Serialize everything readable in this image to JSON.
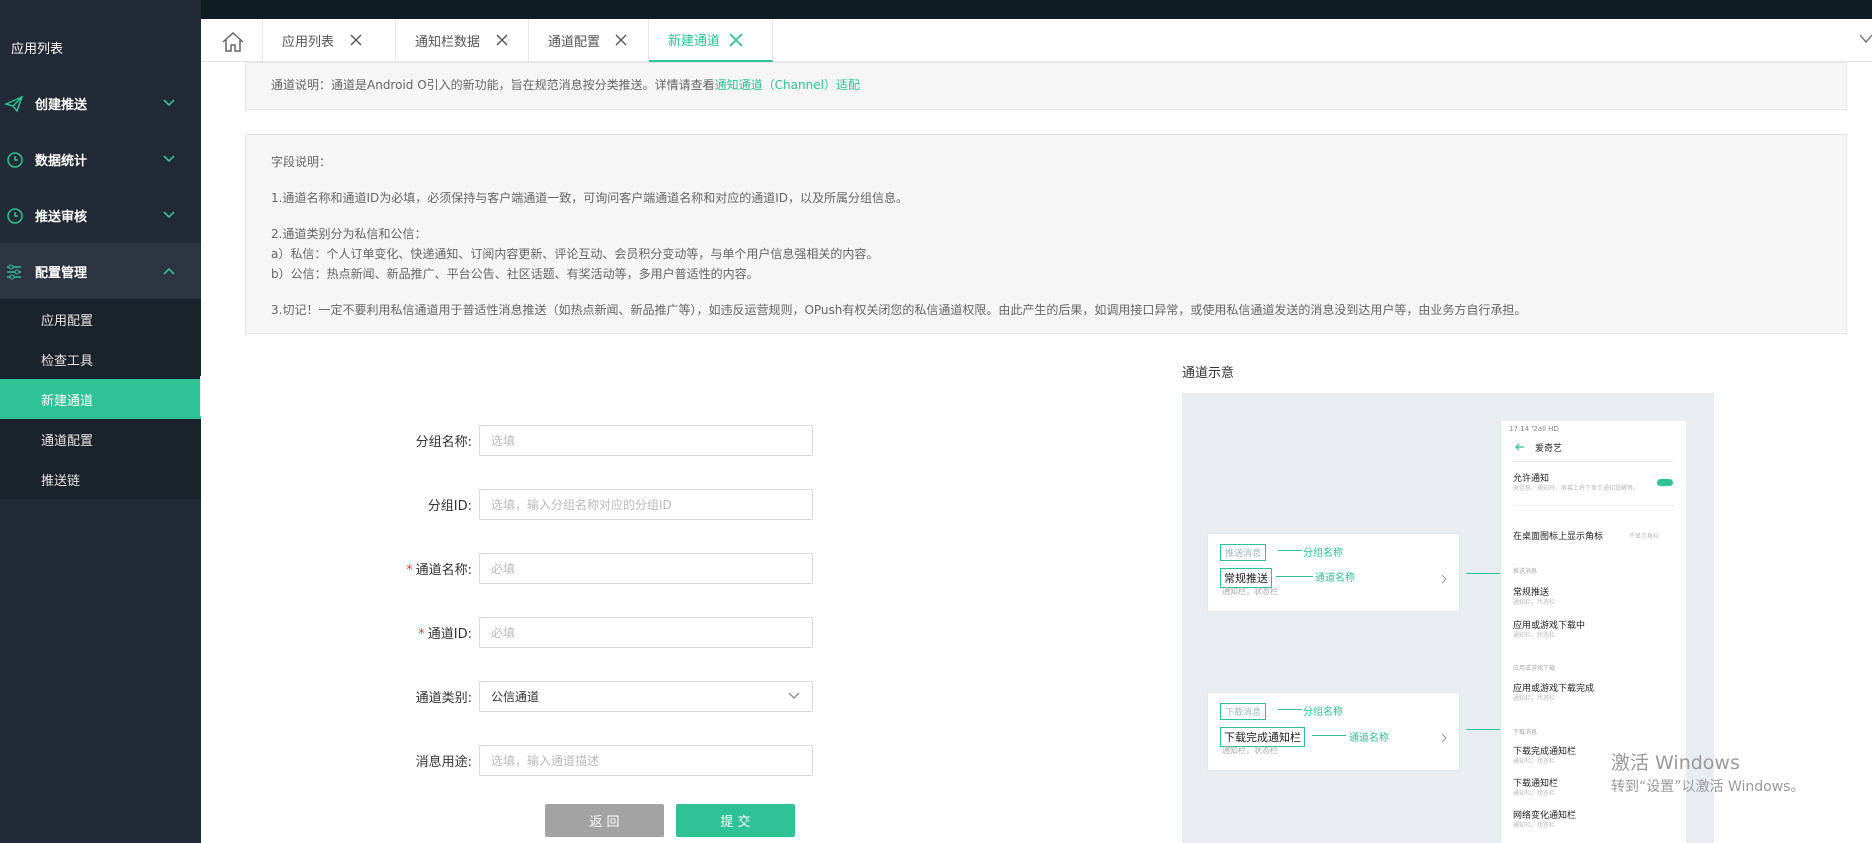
{
  "sidebar": {
    "title": "应用列表",
    "groups": [
      {
        "label": "创建推送"
      },
      {
        "label": "数据统计"
      },
      {
        "label": "推送审核"
      },
      {
        "label": "配置管理"
      }
    ],
    "subitems": [
      "应用配置",
      "检查工具",
      "新建通道",
      "通道配置",
      "推送链"
    ]
  },
  "tabs": [
    {
      "label": "应用列表"
    },
    {
      "label": "通知栏数据"
    },
    {
      "label": "通道配置"
    },
    {
      "label": "新建通道"
    }
  ],
  "notice": {
    "prefix": "通道说明：通道是Android O引入的新功能，旨在规范消息按分类推送。详情请查看",
    "link": "通知通道（Channel）适配"
  },
  "fields_desc": {
    "title": "字段说明：",
    "line1": "1.通道名称和通道ID为必填，必须保持与客户端通道一致，可询问客户端通道名称和对应的通道ID，以及所属分组信息。",
    "line2a": "2.通道类别分为私信和公信：",
    "line2b": "a）私信：个人订单变化、快递通知、订阅内容更新、评论互动、会员积分变动等，与单个用户信息强相关的内容。",
    "line2c": "b）公信：热点新闻、新品推广、平台公告、社区话题、有奖活动等，多用户普适性的内容。",
    "line3": "3.切记！一定不要利用私信通道用于普适性消息推送（如热点新闻、新品推广等），如违反运营规则，OPush有权关闭您的私信通道权限。由此产生的后果，如调用接口异常，或使用私信通道发送的消息没到达用户等，由业务方自行承担。"
  },
  "form": {
    "group_name": {
      "label": "分组名称:",
      "placeholder": "选填"
    },
    "group_id": {
      "label": "分组ID:",
      "placeholder": "选填，输入分组名称对应的分组ID"
    },
    "channel_name": {
      "label": "通道名称:",
      "placeholder": "必填",
      "required_mark": "*"
    },
    "channel_id": {
      "label": "通道ID:",
      "placeholder": "必填",
      "required_mark": "*"
    },
    "channel_type": {
      "label": "通道类别:",
      "value": "公信通道"
    },
    "purpose": {
      "label": "消息用途:",
      "placeholder": "选填，输入通道描述"
    },
    "back_label": "返 回",
    "submit_label": "提 交"
  },
  "demo": {
    "title": "通道示意",
    "card1": {
      "tag": "推送消息",
      "name": "常规推送",
      "sub": "通知栏，状态栏",
      "group_label": "分组名称",
      "channel_label": "通道名称"
    },
    "card2": {
      "tag": "下载消息",
      "name": "下载完成通知栏",
      "sub": "通知栏，状态栏",
      "group_label": "分组名称",
      "channel_label": "通道名称"
    },
    "phone": {
      "status_time": "17:14 '2all HD",
      "app_name": "爱奇艺",
      "allow": "允许通知",
      "allow_desc": "来信息、通知时，屏幕上将下显示通知提醒等。",
      "badge": "在桌面图标上显示角标",
      "badge_value": "不显示角标",
      "section1": "推送消息",
      "item1": "常规推送",
      "item1_sub": "通知栏，状态栏",
      "item2": "应用或游戏下载中",
      "item2_sub": "通知栏，状态栏",
      "section2": "应用或游戏下载",
      "item3": "应用或游戏下载完成",
      "item3_sub": "通知栏，状态栏",
      "section3": "下载消息",
      "item4": "下载完成通知栏",
      "item4_sub": "通知栏，状态栏",
      "item5": "下载通知栏",
      "item5_sub": "通知栏，状态栏",
      "item6": "网络变化通知栏",
      "item6_sub": "通知栏，状态栏"
    }
  },
  "watermark": {
    "line1": "激活 Windows",
    "line2": "转到“设置”以激活 Windows。"
  },
  "colors": {
    "accent": "#2ec294",
    "sidebar": "#222b35",
    "topbar": "#0e1d22"
  }
}
